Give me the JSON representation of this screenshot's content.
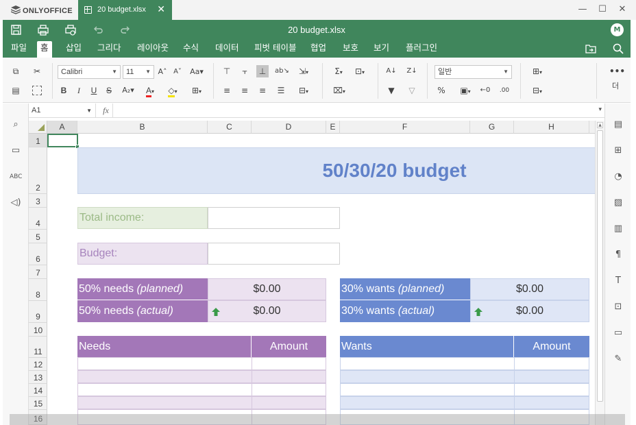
{
  "app": {
    "brand": "ONLYOFFICE",
    "file_tab": "20 budget.xlsx",
    "doc_title": "20 budget.xlsx",
    "avatar": "M"
  },
  "menu": [
    "파일",
    "홈",
    "삽입",
    "그리다",
    "레이아웃",
    "수식",
    "데이터",
    "피벗 테이블",
    "협업",
    "보호",
    "보기",
    "플러그인"
  ],
  "toolbar": {
    "font_name": "Calibri",
    "font_size": "11",
    "number_format": "일반",
    "more_label": "더"
  },
  "formula": {
    "cell_ref": "A1",
    "fx": "fx",
    "content": ""
  },
  "columns": [
    "A",
    "B",
    "C",
    "D",
    "E",
    "F",
    "G",
    "H"
  ],
  "rows": [
    "1",
    "2",
    "3",
    "4",
    "5",
    "6",
    "7",
    "8",
    "9",
    "10",
    "11",
    "12",
    "13",
    "14",
    "15",
    "16"
  ],
  "sheet": {
    "title": "50/30/20 budget",
    "total_income_label": "Total income:",
    "budget_label": "Budget:",
    "needs_planned_label": "50% needs",
    "needs_planned_tag": "(planned)",
    "needs_planned_value": "$0.00",
    "needs_actual_label": "50% needs",
    "needs_actual_tag": "(actual)",
    "needs_actual_value": "$0.00",
    "wants_planned_label": "30% wants",
    "wants_planned_tag": "(planned)",
    "wants_planned_value": "$0.00",
    "wants_actual_label": "30% wants",
    "wants_actual_tag": "(actual)",
    "wants_actual_value": "$0.00",
    "needs_header": "Needs",
    "needs_amount_header": "Amount",
    "wants_header": "Wants",
    "wants_amount_header": "Amount"
  },
  "colors": {
    "brand_green": "#40865c",
    "title_band": "#dce5f5",
    "title_text": "#6182c9",
    "income_fill": "#e6efdf",
    "income_text": "#9bba86",
    "budget_fill": "#ece3f0",
    "budget_text": "#a784bd",
    "needs_purple": "#a377b8",
    "needs_light": "#ece2f0",
    "wants_blue": "#6a89d0",
    "wants_light": "#dfe6f6",
    "arrow_green": "#3a9a48"
  }
}
